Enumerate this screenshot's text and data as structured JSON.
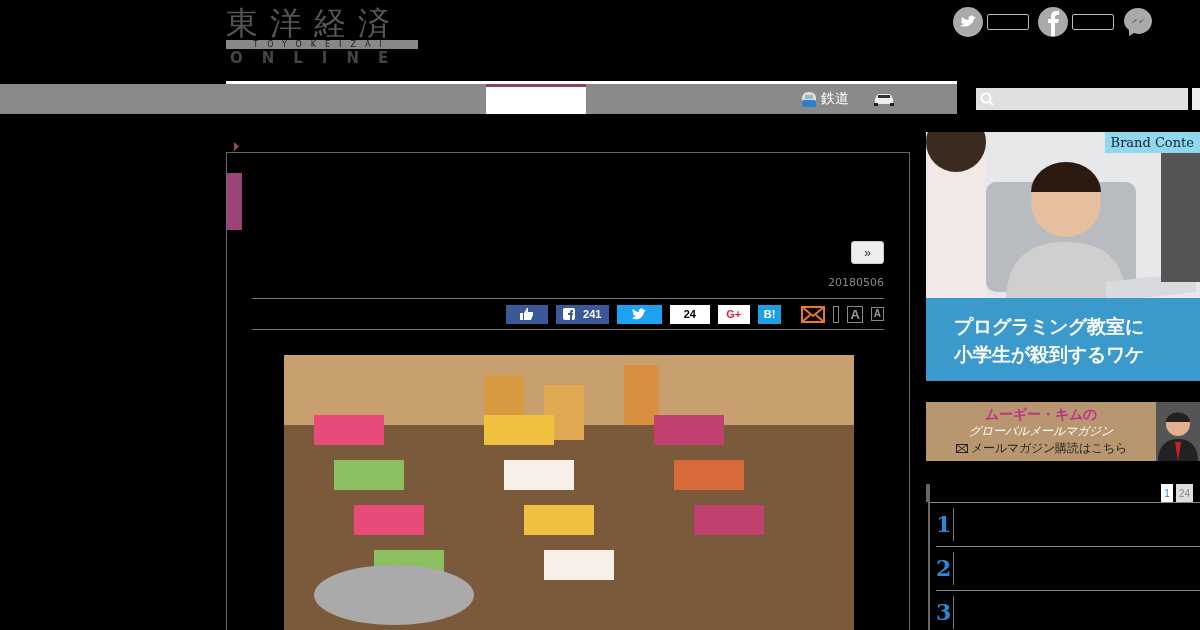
{
  "logo": {
    "title": "東洋経済",
    "band": "TOYOKEIZAI",
    "subtitle": "ONLINE"
  },
  "social": [
    {
      "kind": "twitter"
    },
    {
      "kind": "facebook"
    },
    {
      "kind": "messenger"
    }
  ],
  "nav": {
    "items": [
      {
        "kind": "train",
        "label": "鉄道"
      },
      {
        "kind": "car"
      }
    ]
  },
  "article": {
    "next_button": "»",
    "date": "20180506",
    "share": [
      {
        "kind": "like"
      },
      {
        "kind": "facebook",
        "count": "241"
      },
      {
        "kind": "twitter"
      },
      {
        "kind": "pocket",
        "count": "24"
      },
      {
        "kind": "gplus",
        "label": "G+"
      },
      {
        "kind": "hatena",
        "label": "B!"
      },
      {
        "kind": "mail"
      }
    ],
    "font_sizes": [
      {
        "label": "A",
        "selected": true
      },
      {
        "label": "A",
        "selected": false
      }
    ]
  },
  "sidebar": {
    "ad": {
      "badge": "Brand Conte",
      "headline": [
        "プログラミング教室に",
        "小学生が殺到するワケ"
      ]
    },
    "banner": {
      "title": "ムーギー・キムの",
      "subtitle": "グローバルメールマガジン",
      "link": "メールマガジン購読はこちら"
    },
    "ranking": {
      "tabs": [
        {
          "label": "1",
          "selected": true
        },
        {
          "label": "24",
          "selected": false
        }
      ],
      "rows": [
        {
          "rank": "1"
        },
        {
          "rank": "2"
        },
        {
          "rank": "3"
        }
      ]
    }
  }
}
